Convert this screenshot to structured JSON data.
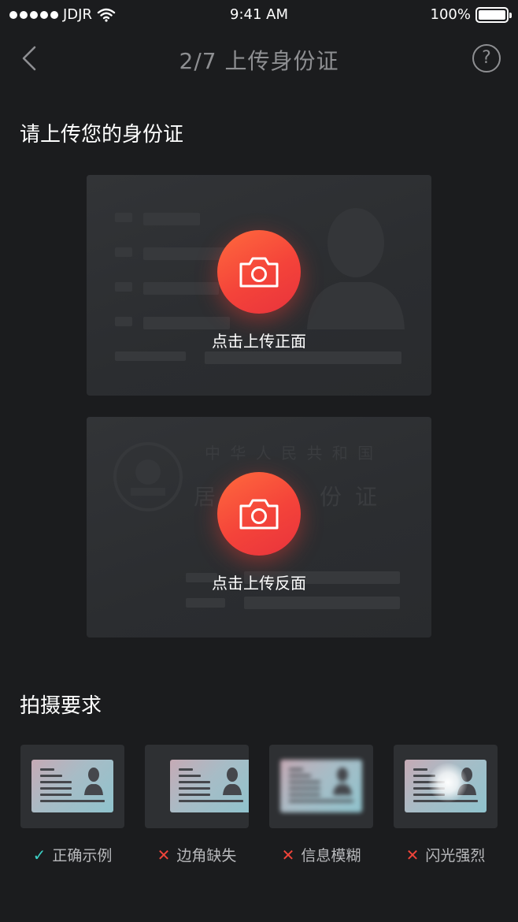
{
  "status_bar": {
    "carrier": "JDJR",
    "time": "9:41 AM",
    "battery": "100%"
  },
  "nav": {
    "title": "2/7 上传身份证",
    "back_icon": "chevron-left-icon",
    "help_icon": "question-circle-icon",
    "help_glyph": "?"
  },
  "upload": {
    "heading": "请上传您的身份证",
    "front_label": "点击上传正面",
    "back_label": "点击上传反面",
    "camera_icon": "camera-icon",
    "back_card_header": "中 华 人 民 共 和 国",
    "back_card_title_left": "居",
    "back_card_title_right": "份 证"
  },
  "requirements": {
    "heading": "拍摄要求",
    "items": [
      {
        "label": "正确示例",
        "status": "correct"
      },
      {
        "label": "边角缺失",
        "status": "wrong"
      },
      {
        "label": "信息模糊",
        "status": "wrong"
      },
      {
        "label": "闪光强烈",
        "status": "wrong"
      }
    ]
  },
  "colors": {
    "background": "#1b1c1e",
    "accent": "#f4433a",
    "check": "#3ccfc4",
    "cross": "#f0443a"
  }
}
